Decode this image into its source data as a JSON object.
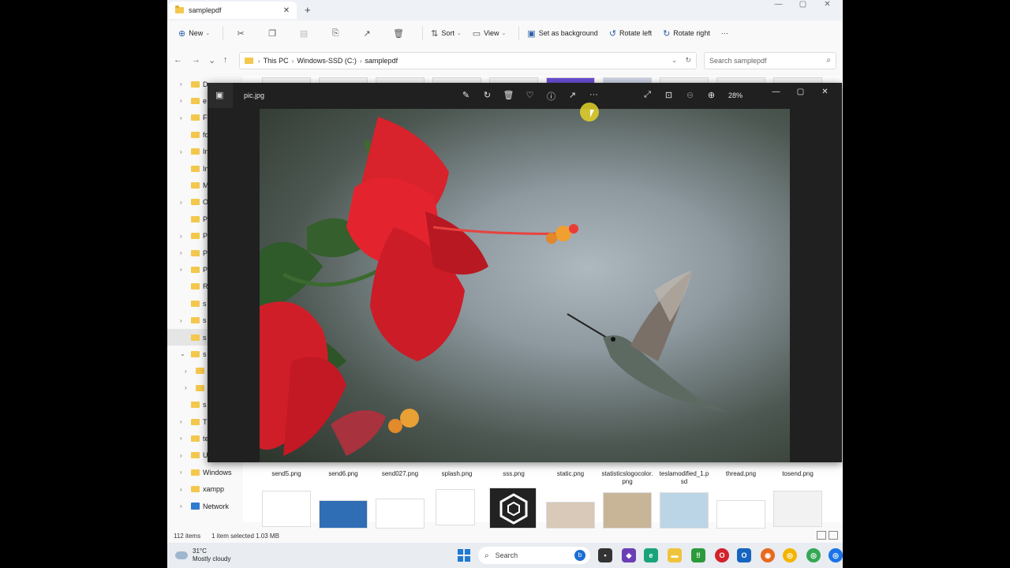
{
  "explorer": {
    "tab_title": "samplepdf",
    "new_tab": "+",
    "toolbar": {
      "new": "New",
      "sort": "Sort",
      "view": "View",
      "set_background": "Set as background",
      "rotate_left": "Rotate left",
      "rotate_right": "Rotate right",
      "more": "···"
    },
    "breadcrumbs": [
      "This PC",
      "Windows-SSD (C:)",
      "samplepdf"
    ],
    "search_placeholder": "Search samplepdf",
    "sidebar": {
      "items": [
        "De",
        "e",
        "F",
        "fo",
        "In",
        "In",
        "M",
        "O",
        "P",
        "P",
        "P",
        "P",
        "R",
        "s",
        "s",
        "s",
        "s",
        "",
        "",
        "s",
        "T",
        "te",
        "U",
        "Windows",
        "xampp",
        "Network"
      ]
    },
    "files": [
      "send5.png",
      "send6.png",
      "send027.png",
      "splash.png",
      "sss.png",
      "static.png",
      "statisticslogocolor.png",
      "teslamodified_1.psd",
      "thread.png",
      "tosend.png"
    ],
    "status": {
      "count": "112 items",
      "selected": "1 item selected  1.03 MB"
    }
  },
  "taskbar": {
    "temp": "31°C",
    "weather": "Mostly cloudy",
    "search": "Search"
  },
  "viewer": {
    "title": "pic.jpg",
    "zoom": "28%"
  },
  "icons": {
    "folder": "folder-icon",
    "accent": "#1e78d6"
  }
}
